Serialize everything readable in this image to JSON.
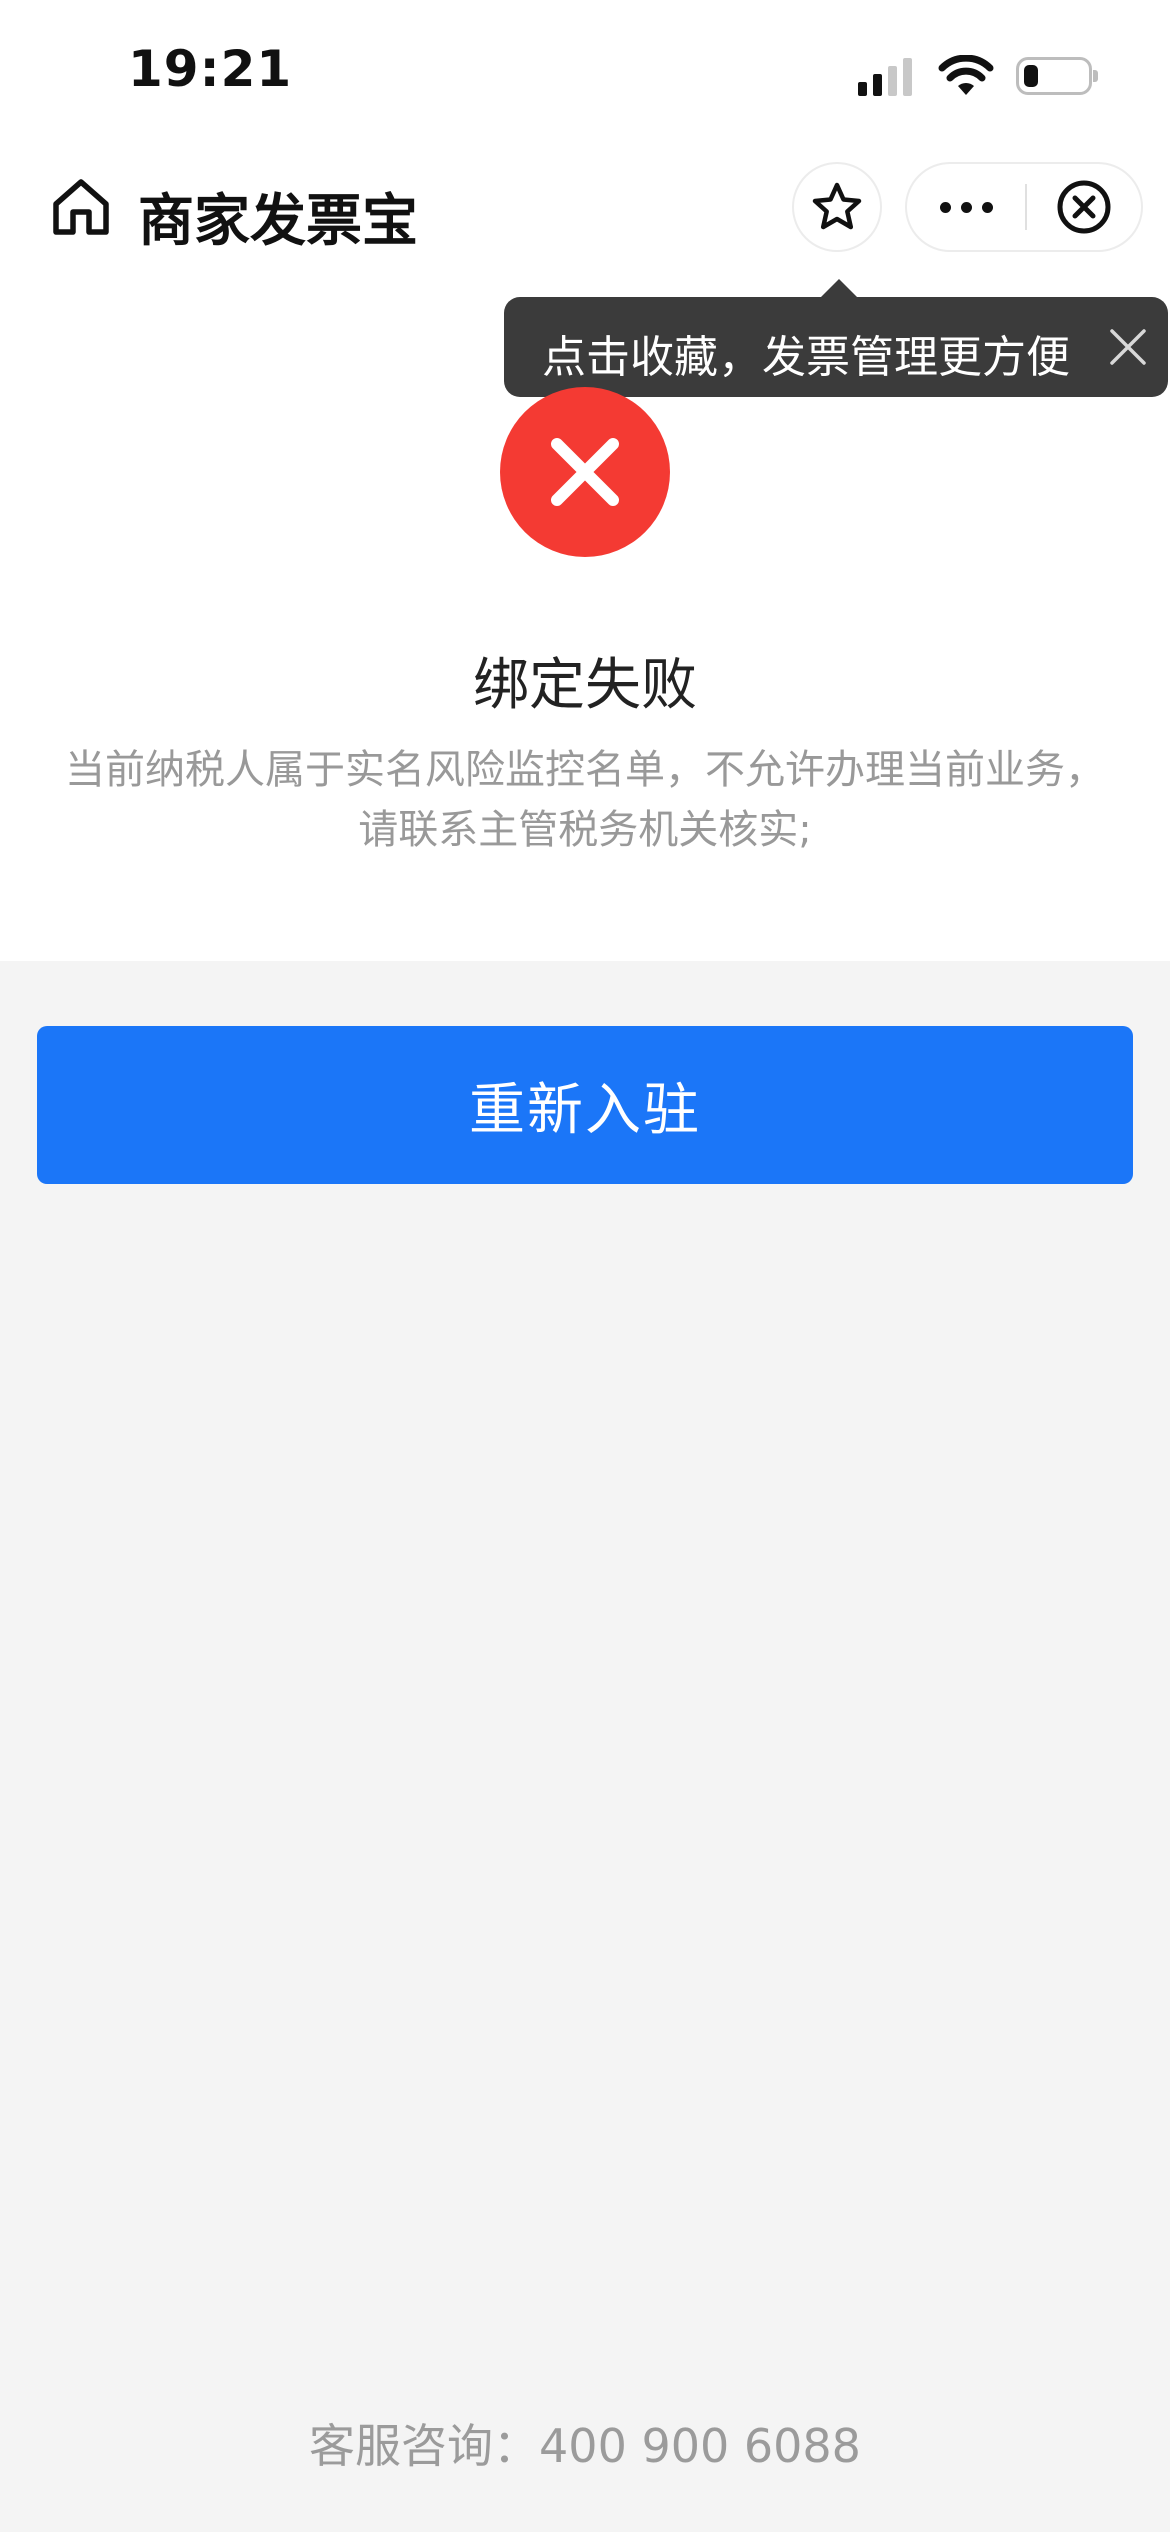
{
  "status_bar": {
    "time": "19:21"
  },
  "nav": {
    "title": "商家发票宝"
  },
  "tooltip": {
    "text": "点击收藏，发票管理更方便"
  },
  "result": {
    "title": "绑定失败",
    "description_line1": "当前纳税人属于实名风险监控名单，不允许办理当前业务，",
    "description_line2": "请联系主管税务机关核实;"
  },
  "actions": {
    "rejoin_label": "重新入驻"
  },
  "footer": {
    "contact": "客服咨询：400 900 6088"
  },
  "colors": {
    "accent": "#1b76f8",
    "error": "#f43a33",
    "tooltip_bg": "#3b3b3b"
  },
  "icons": [
    "home-icon",
    "star-icon",
    "more-icon",
    "close-circle-icon",
    "close-icon",
    "error-icon",
    "signal-icon",
    "wifi-icon",
    "battery-icon"
  ]
}
